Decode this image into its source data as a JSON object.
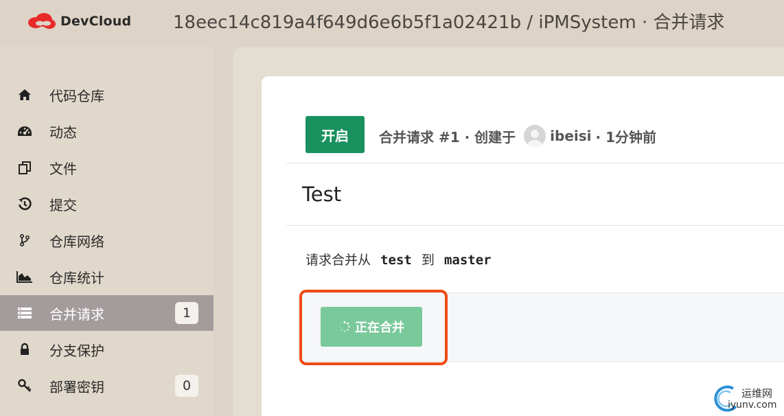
{
  "header": {
    "brand_name": "DevCloud",
    "page_heading": "18eec14c819a4f649d6e6b5f1a02421b / iPMSystem · 合并请求"
  },
  "sidebar": {
    "items": [
      {
        "label": "代码仓库",
        "icon": "home-icon"
      },
      {
        "label": "动态",
        "icon": "dashboard-icon"
      },
      {
        "label": "文件",
        "icon": "files-icon"
      },
      {
        "label": "提交",
        "icon": "history-icon"
      },
      {
        "label": "仓库网络",
        "icon": "branch-icon"
      },
      {
        "label": "仓库统计",
        "icon": "area-chart-icon"
      },
      {
        "label": "合并请求",
        "icon": "list-icon",
        "badge": "1",
        "active": true
      },
      {
        "label": "分支保护",
        "icon": "lock-icon"
      },
      {
        "label": "部署密钥",
        "icon": "key-icon",
        "badge": "0"
      }
    ]
  },
  "merge_request": {
    "status": "开启",
    "meta_prefix": "合并请求 #1 · 创建于",
    "author": "ibeisi",
    "time": "· 1分钟前",
    "title": "Test",
    "merge_from_label": "请求合并从",
    "source_branch": "test",
    "to_label": "到",
    "target_branch": "master",
    "merging_button": "正在合并"
  },
  "watermark": {
    "line1": "运维网",
    "line2": "iyunv.com"
  },
  "colors": {
    "status_green": "#19915f",
    "merging_green": "#79c99a",
    "highlight": "#f04a14",
    "brand_red": "#e8292a",
    "active_nav": "#a49c9c"
  }
}
